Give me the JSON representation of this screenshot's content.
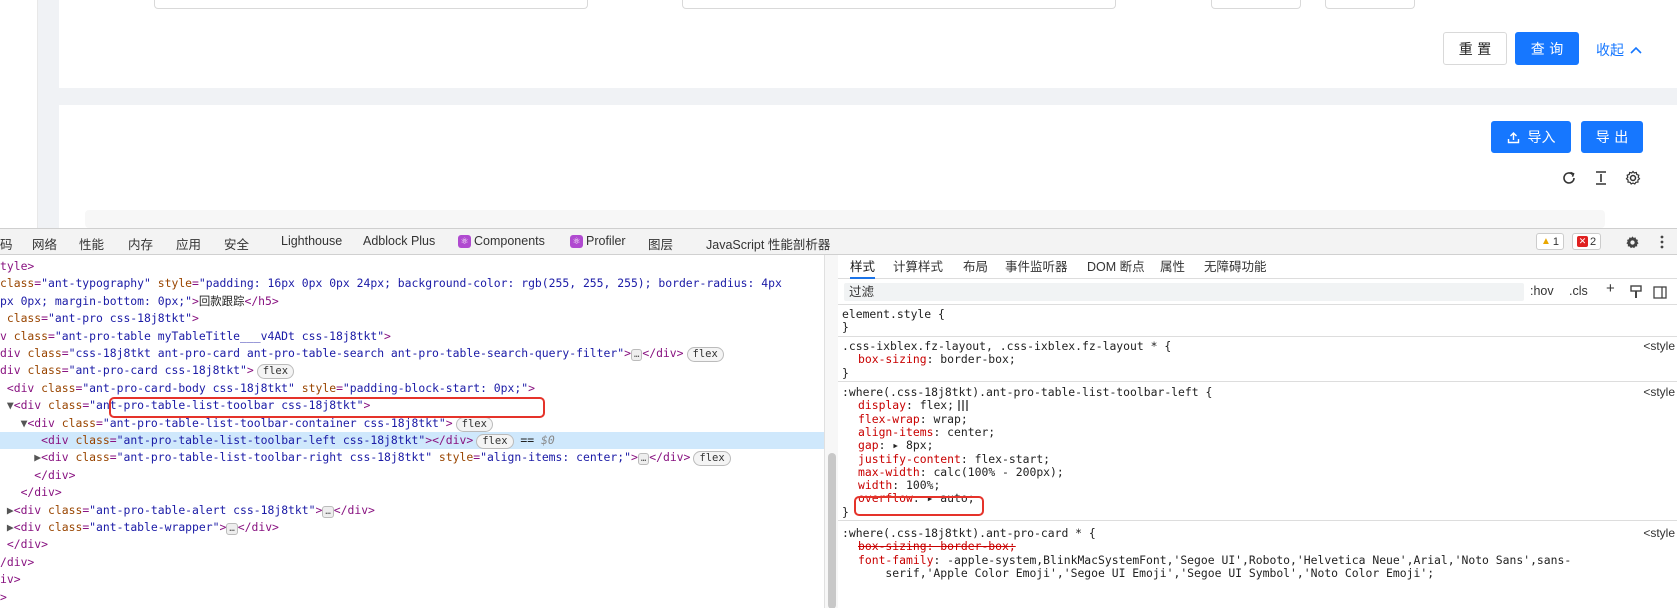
{
  "app": {
    "query_form": {
      "reset_label": "重 置",
      "search_label": "查 询",
      "collapse_label": "收起"
    },
    "toolbar": {
      "import_label": "导入",
      "export_label": "导 出"
    }
  },
  "devtools": {
    "tabs": [
      "码",
      "网络",
      "性能",
      "内存",
      "应用",
      "安全",
      "Lighthouse",
      "Adblock Plus",
      "Components",
      "Profiler",
      "图层",
      "JavaScript 性能剖析器"
    ],
    "warnings_count": "1",
    "errors_count": "2",
    "elements_lines": [
      {
        "indent": "",
        "parts": [
          [
            "tag",
            "tyle>"
          ]
        ]
      },
      {
        "indent": "",
        "parts": [
          [
            "an",
            "class"
          ],
          [
            "tag",
            "="
          ],
          [
            "av",
            "\"ant-typography\""
          ],
          [
            "an",
            " style"
          ],
          [
            "tag",
            "="
          ],
          [
            "av",
            "\"padding: 16px 0px 0px 24px; background-color: rgb(255, 255, 255); border-radius: 4px"
          ]
        ]
      },
      {
        "indent": "",
        "parts": [
          [
            "av",
            "px 0px; margin-bottom: 0px;\""
          ],
          [
            "tag",
            ">"
          ],
          [
            "tx",
            "回款跟踪"
          ],
          [
            "tag",
            "</h5>"
          ]
        ]
      },
      {
        "indent": " ",
        "parts": [
          [
            "an",
            "class"
          ],
          [
            "tag",
            "="
          ],
          [
            "av",
            "\"ant-pro css-18j8tkt\""
          ],
          [
            "tag",
            ">"
          ]
        ]
      },
      {
        "indent": "",
        "parts": [
          [
            "tag",
            "v "
          ],
          [
            "an",
            "class"
          ],
          [
            "tag",
            "="
          ],
          [
            "av",
            "\"ant-pro-table myTableTitle___v4ADt css-18j8tkt\""
          ],
          [
            "tag",
            ">"
          ]
        ]
      },
      {
        "indent": "",
        "parts": [
          [
            "tag",
            "div "
          ],
          [
            "an",
            "class"
          ],
          [
            "tag",
            "="
          ],
          [
            "av",
            "\"css-18j8tkt ant-pro-card ant-pro-table-search ant-pro-table-search-query-filter\""
          ],
          [
            "tag",
            ">"
          ],
          [
            "ell",
            "…"
          ],
          [
            "tag",
            "</div>"
          ],
          [
            "badge",
            "flex"
          ]
        ]
      },
      {
        "indent": "",
        "parts": [
          [
            "tag",
            "div "
          ],
          [
            "an",
            "class"
          ],
          [
            "tag",
            "="
          ],
          [
            "av",
            "\"ant-pro-card css-18j8tkt\""
          ],
          [
            "tag",
            ">"
          ],
          [
            "badge",
            "flex"
          ]
        ]
      },
      {
        "indent": " ",
        "parts": [
          [
            "tag",
            "<div "
          ],
          [
            "an",
            "class"
          ],
          [
            "tag",
            "="
          ],
          [
            "av",
            "\"ant-pro-card-body css-18j8tkt\""
          ],
          [
            "an",
            " style"
          ],
          [
            "tag",
            "="
          ],
          [
            "av",
            "\"padding-block-start: 0px;\""
          ],
          [
            "tag",
            ">"
          ]
        ]
      },
      {
        "indent": " ▼",
        "parts": [
          [
            "tag",
            "<div "
          ],
          [
            "an",
            "class"
          ],
          [
            "tag",
            "="
          ],
          [
            "av",
            "\"ant-pro-table-list-toolbar css-18j8tkt\""
          ],
          [
            "tag",
            ">"
          ]
        ]
      },
      {
        "indent": "   ▼",
        "parts": [
          [
            "tag",
            "<div "
          ],
          [
            "an",
            "class"
          ],
          [
            "tag",
            "="
          ],
          [
            "av",
            "\"ant-pro-table-list-toolbar-container css-18j8tkt\""
          ],
          [
            "tag",
            ">"
          ],
          [
            "badge",
            "flex"
          ]
        ]
      },
      {
        "indent": "      ",
        "parts": [
          [
            "tag",
            "<div "
          ],
          [
            "an",
            "class"
          ],
          [
            "tag",
            "="
          ],
          [
            "av",
            "\"ant-pro-table-list-toolbar-left css-18j8tkt\""
          ],
          [
            "tag",
            "></div>"
          ],
          [
            "badge",
            "flex"
          ],
          [
            "tx",
            " == "
          ],
          [
            "dollar",
            "$0"
          ]
        ],
        "selected": true
      },
      {
        "indent": "     ▶",
        "parts": [
          [
            "tag",
            "<div "
          ],
          [
            "an",
            "class"
          ],
          [
            "tag",
            "="
          ],
          [
            "av",
            "\"ant-pro-table-list-toolbar-right css-18j8tkt\""
          ],
          [
            "an",
            " style"
          ],
          [
            "tag",
            "="
          ],
          [
            "av",
            "\"align-items: center;\""
          ],
          [
            "tag",
            ">"
          ],
          [
            "ell",
            "…"
          ],
          [
            "tag",
            "</div>"
          ],
          [
            "badge",
            "flex"
          ]
        ]
      },
      {
        "indent": "     ",
        "parts": [
          [
            "tag",
            "</div>"
          ]
        ]
      },
      {
        "indent": "   ",
        "parts": [
          [
            "tag",
            "</div>"
          ]
        ]
      },
      {
        "indent": " ▶",
        "parts": [
          [
            "tag",
            "<div "
          ],
          [
            "an",
            "class"
          ],
          [
            "tag",
            "="
          ],
          [
            "av",
            "\"ant-pro-table-alert css-18j8tkt\""
          ],
          [
            "tag",
            ">"
          ],
          [
            "ell",
            "…"
          ],
          [
            "tag",
            "</div>"
          ]
        ]
      },
      {
        "indent": " ▶",
        "parts": [
          [
            "tag",
            "<div "
          ],
          [
            "an",
            "class"
          ],
          [
            "tag",
            "="
          ],
          [
            "av",
            "\"ant-table-wrapper\""
          ],
          [
            "tag",
            ">"
          ],
          [
            "ell",
            "…"
          ],
          [
            "tag",
            "</div>"
          ]
        ]
      },
      {
        "indent": " ",
        "parts": [
          [
            "tag",
            "</div>"
          ]
        ]
      },
      {
        "indent": "",
        "parts": [
          [
            "tag",
            "/div>"
          ]
        ]
      },
      {
        "indent": "",
        "parts": [
          [
            "tag",
            "iv>"
          ]
        ]
      },
      {
        "indent": "",
        "parts": [
          [
            "tag",
            ">"
          ]
        ]
      }
    ],
    "styles_tabs": [
      "样式",
      "计算样式",
      "布局",
      "事件监听器",
      "DOM 断点",
      "属性",
      "无障碍功能"
    ],
    "filter_placeholder": "过滤",
    "filter_actions": [
      ":hov",
      ".cls",
      "+"
    ],
    "rules": [
      {
        "selector": "element.style {",
        "source": "",
        "decls": [],
        "close": "}"
      },
      {
        "selector": ".css-ixblex.fz-layout, .css-ixblex.fz-layout * {",
        "source": "<style",
        "decls": [
          [
            "box-sizing",
            "border-box;",
            false
          ]
        ],
        "close": "}"
      },
      {
        "selector": ":where(.css-18j8tkt).ant-pro-table-list-toolbar-left {",
        "source": "<style",
        "decls": [
          [
            "display",
            "flex;",
            false
          ],
          [
            "flex-wrap",
            "wrap;",
            false
          ],
          [
            "align-items",
            "center;",
            false
          ],
          [
            "gap",
            "▸ 8px;",
            false
          ],
          [
            "justify-content",
            "flex-start;",
            false
          ],
          [
            "max-width",
            "calc(100% - 200px);",
            false
          ],
          [
            "width",
            "100%;",
            false
          ],
          [
            "overflow",
            "▸ auto;",
            false
          ]
        ],
        "close": "}"
      },
      {
        "selector": ":where(.css-18j8tkt).ant-pro-card * {",
        "source": "<style",
        "decls": [
          [
            "box-sizing",
            "border-box;",
            true
          ],
          [
            "font-family",
            "-apple-system,BlinkMacSystemFont,'Segoe UI',Roboto,'Helvetica Neue',Arial,'Noto Sans',sans-",
            false
          ]
        ],
        "cont": "    serif,'Apple Color Emoji','Segoe UI Emoji','Segoe UI Symbol','Noto Color Emoji';",
        "close": ""
      }
    ]
  }
}
